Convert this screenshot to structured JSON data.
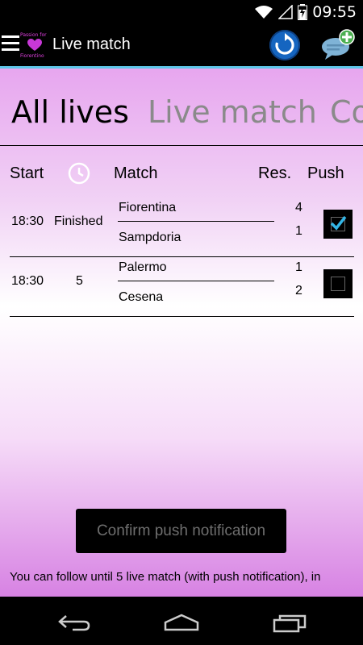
{
  "status_bar": {
    "time": "09:55"
  },
  "app_bar": {
    "title": "Live match",
    "logo": {
      "line1": "Passion for",
      "line2": "Fiorentino"
    }
  },
  "tabs": [
    {
      "label": "All lives",
      "active": true
    },
    {
      "label": "Live match",
      "active": false
    },
    {
      "label": "Co",
      "active": false
    }
  ],
  "table": {
    "headers": {
      "start": "Start",
      "match": "Match",
      "result": "Res.",
      "push": "Push"
    },
    "rows": [
      {
        "start": "18:30",
        "status": "Finished",
        "home": "Fiorentina",
        "away": "Sampdoria",
        "home_score": "4",
        "away_score": "1",
        "push": true
      },
      {
        "start": "18:30",
        "status": "5",
        "home": "Palermo",
        "away": "Cesena",
        "home_score": "1",
        "away_score": "2",
        "push": false
      }
    ]
  },
  "confirm_button": "Confirm push notification",
  "info_text": "You can follow until 5 live match (with push notification), in",
  "colors": {
    "accent": "#5ec6e8",
    "check": "#33b5e5",
    "gradient_top": "#e7a6ef",
    "gradient_bottom": "#d782e3"
  }
}
